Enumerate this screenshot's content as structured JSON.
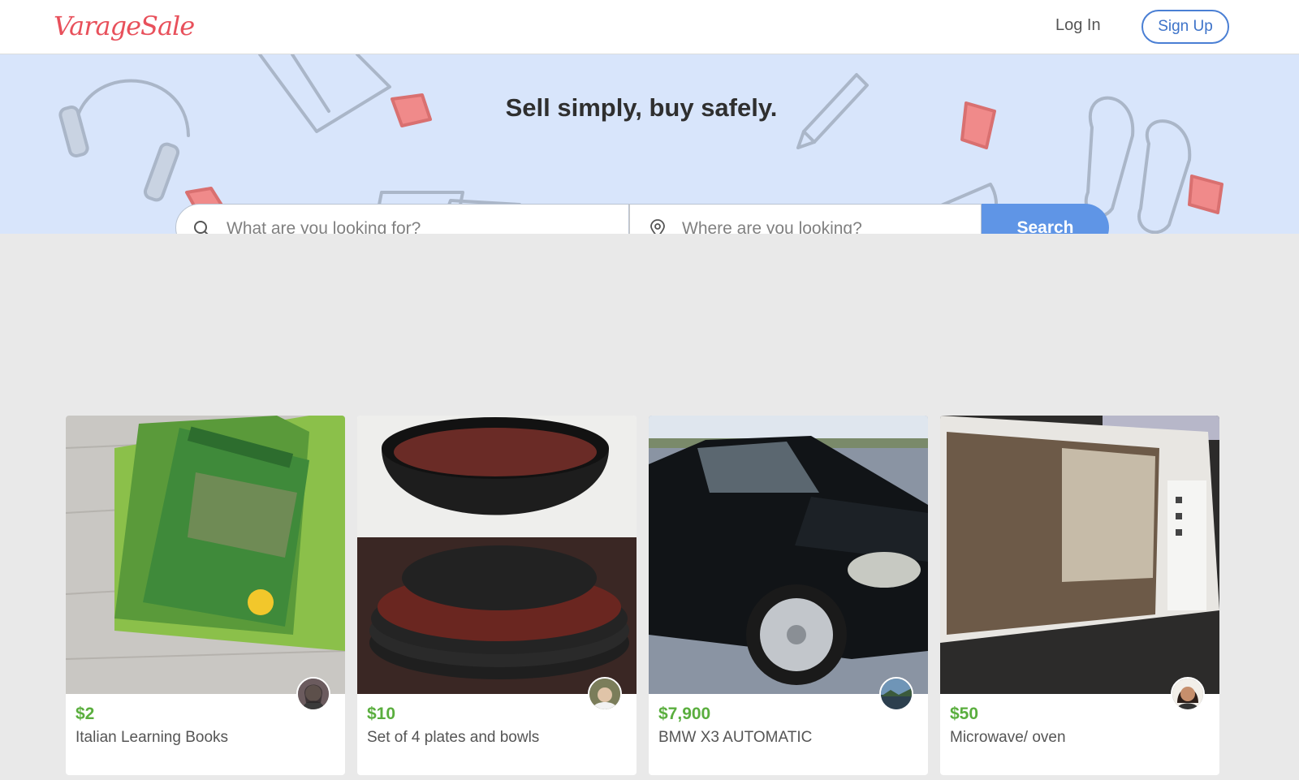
{
  "header": {
    "logo_text": "VarageSale",
    "login_label": "Log In",
    "signup_label": "Sign Up"
  },
  "hero": {
    "tagline": "Sell simply, buy safely.",
    "search": {
      "what_placeholder": "What are you looking for?",
      "where_placeholder": "Where are you looking?",
      "button_label": "Search"
    }
  },
  "listings": [
    {
      "price": "$2",
      "title": "Italian Learning Books",
      "photo": "books"
    },
    {
      "price": "$10",
      "title": "Set of 4 plates and bowls",
      "photo": "plates"
    },
    {
      "price": "$7,900",
      "title": "BMW X3 AUTOMATIC",
      "photo": "car"
    },
    {
      "price": "$50",
      "title": "Microwave/ oven",
      "photo": "microwave"
    }
  ],
  "colors": {
    "brand": "#e8505b",
    "accent": "#5f95e6",
    "price": "#5aae3e",
    "hero_bg": "#d8e5fb",
    "page_bg": "#e9e9e9"
  },
  "icons": [
    "search-icon",
    "location-pin-icon",
    "avatar"
  ]
}
